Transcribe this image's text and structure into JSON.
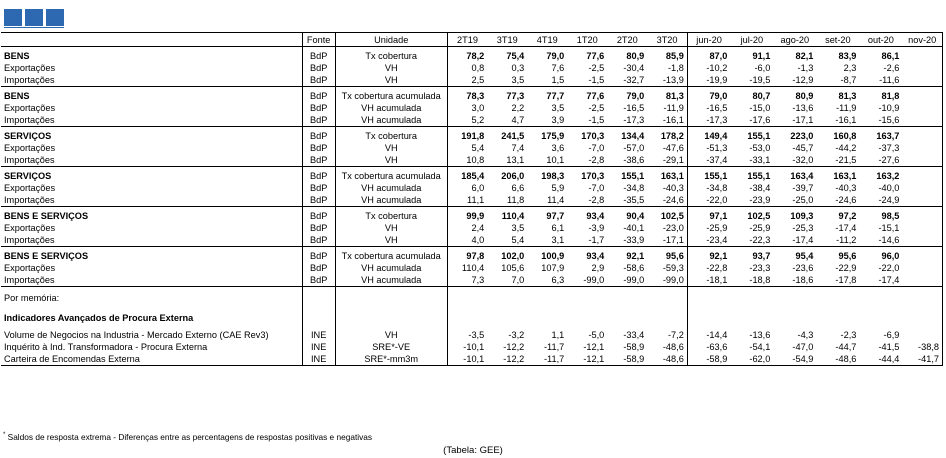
{
  "columns": {
    "fonte": "Fonte",
    "unidade": "Unidade",
    "periods": [
      "2T19",
      "3T19",
      "4T19",
      "1T20",
      "2T20",
      "3T20",
      "jun-20",
      "jul-20",
      "ago-20",
      "set-20",
      "out-20",
      "nov-20"
    ]
  },
  "blocks": [
    {
      "rows": [
        {
          "label": "BENS",
          "src": "BdP",
          "unit": "Tx cobertura",
          "values": [
            "78,2",
            "75,4",
            "79,0",
            "77,6",
            "80,9",
            "85,9",
            "87,0",
            "91,1",
            "82,1",
            "83,9",
            "86,1",
            ""
          ]
        },
        {
          "label": "Exportações",
          "src": "BdP",
          "unit": "VH",
          "values": [
            "0,8",
            "0,3",
            "7,6",
            "-2,5",
            "-30,4",
            "-1,8",
            "-10,2",
            "-6,0",
            "-1,3",
            "2,3",
            "-2,6",
            ""
          ]
        },
        {
          "label": "Importações",
          "src": "BdP",
          "unit": "VH",
          "values": [
            "2,5",
            "3,5",
            "1,5",
            "-1,5",
            "-32,7",
            "-13,9",
            "-19,9",
            "-19,5",
            "-12,9",
            "-8,7",
            "-11,6",
            ""
          ]
        }
      ]
    },
    {
      "rows": [
        {
          "label": "BENS",
          "src": "BdP",
          "unit": "Tx cobertura acumulada",
          "values": [
            "78,3",
            "77,3",
            "77,7",
            "77,6",
            "79,0",
            "81,3",
            "79,0",
            "80,7",
            "80,9",
            "81,3",
            "81,8",
            ""
          ]
        },
        {
          "label": "Exportações",
          "src": "BdP",
          "unit": "VH acumulada",
          "values": [
            "3,0",
            "2,2",
            "3,5",
            "-2,5",
            "-16,5",
            "-11,9",
            "-16,5",
            "-15,0",
            "-13,6",
            "-11,9",
            "-10,9",
            ""
          ]
        },
        {
          "label": "Importações",
          "src": "BdP",
          "unit": "VH acumulada",
          "values": [
            "5,2",
            "4,7",
            "3,9",
            "-1,5",
            "-17,3",
            "-16,1",
            "-17,3",
            "-17,6",
            "-17,1",
            "-16,1",
            "-15,6",
            ""
          ]
        }
      ]
    },
    {
      "rows": [
        {
          "label": "SERVIÇOS",
          "src": "BdP",
          "unit": "Tx cobertura",
          "values": [
            "191,8",
            "241,5",
            "175,9",
            "170,3",
            "134,4",
            "178,2",
            "149,4",
            "155,1",
            "223,0",
            "160,8",
            "163,7",
            ""
          ]
        },
        {
          "label": "Exportações",
          "src": "BdP",
          "unit": "VH",
          "values": [
            "5,4",
            "7,4",
            "3,6",
            "-7,0",
            "-57,0",
            "-47,6",
            "-51,3",
            "-53,0",
            "-45,7",
            "-44,2",
            "-37,3",
            ""
          ]
        },
        {
          "label": "Importações",
          "src": "BdP",
          "unit": "VH",
          "values": [
            "10,8",
            "13,1",
            "10,1",
            "-2,8",
            "-38,6",
            "-29,1",
            "-37,4",
            "-33,1",
            "-32,0",
            "-21,5",
            "-27,6",
            ""
          ]
        }
      ]
    },
    {
      "rows": [
        {
          "label": "SERVIÇOS",
          "src": "BdP",
          "unit": "Tx cobertura acumulada",
          "values": [
            "185,4",
            "206,0",
            "198,3",
            "170,3",
            "155,1",
            "163,1",
            "155,1",
            "155,1",
            "163,4",
            "163,1",
            "163,2",
            ""
          ]
        },
        {
          "label": "Exportações",
          "src": "BdP",
          "unit": "VH acumulada",
          "values": [
            "6,0",
            "6,6",
            "5,9",
            "-7,0",
            "-34,8",
            "-40,3",
            "-34,8",
            "-38,4",
            "-39,7",
            "-40,3",
            "-40,0",
            ""
          ]
        },
        {
          "label": "Importações",
          "src": "BdP",
          "unit": "VH acumulada",
          "values": [
            "11,1",
            "11,8",
            "11,4",
            "-2,8",
            "-35,5",
            "-24,6",
            "-22,0",
            "-23,9",
            "-25,0",
            "-24,6",
            "-24,9",
            ""
          ]
        }
      ]
    },
    {
      "rows": [
        {
          "label": "BENS E SERVIÇOS",
          "src": "BdP",
          "unit": "Tx cobertura",
          "values": [
            "99,9",
            "110,4",
            "97,7",
            "93,4",
            "90,4",
            "102,5",
            "97,1",
            "102,5",
            "109,3",
            "97,2",
            "98,5",
            ""
          ]
        },
        {
          "label": "Exportações",
          "src": "BdP",
          "unit": "VH",
          "values": [
            "2,4",
            "3,5",
            "6,1",
            "-3,9",
            "-40,1",
            "-23,0",
            "-25,9",
            "-25,9",
            "-25,3",
            "-17,4",
            "-15,1",
            ""
          ]
        },
        {
          "label": "Importações",
          "src": "BdP",
          "unit": "VH",
          "values": [
            "4,0",
            "5,4",
            "3,1",
            "-1,7",
            "-33,9",
            "-17,1",
            "-23,4",
            "-22,3",
            "-17,4",
            "-11,2",
            "-14,6",
            ""
          ]
        }
      ]
    },
    {
      "rows": [
        {
          "label": "BENS E SERVIÇOS",
          "src": "BdP",
          "unit": "Tx cobertura acumulada",
          "values": [
            "97,8",
            "102,0",
            "100,9",
            "93,4",
            "92,1",
            "95,6",
            "92,1",
            "93,7",
            "95,4",
            "95,6",
            "96,0",
            ""
          ]
        },
        {
          "label": "Exportações",
          "src": "BdP",
          "unit": "VH acumulada",
          "values": [
            "110,4",
            "105,6",
            "107,9",
            "2,9",
            "-58,6",
            "-59,3",
            "-22,8",
            "-23,3",
            "-23,6",
            "-22,9",
            "-22,0",
            ""
          ]
        },
        {
          "label": "Importações",
          "src": "BdP",
          "unit": "VH acumulada",
          "values": [
            "7,3",
            "7,0",
            "6,3",
            "-99,0",
            "-99,0",
            "-99,0",
            "-18,1",
            "-18,8",
            "-18,6",
            "-17,8",
            "-17,4",
            ""
          ]
        }
      ]
    }
  ],
  "memo": {
    "title": "Por memória:",
    "subtitle": "Indicadores Avançados de Procura Externa",
    "rows": [
      {
        "label": "Volume de Negocios na Industria - Mercado Externo (CAE Rev3)",
        "src": "INE",
        "unit": "VH",
        "values": [
          "-3,5",
          "-3,2",
          "1,1",
          "-5,0",
          "-33,4",
          "-7,2",
          "-14,4",
          "-13,6",
          "-4,3",
          "-2,3",
          "-6,9",
          ""
        ]
      },
      {
        "label": "Inquérito à Ind. Transformadora - Procura Externa",
        "src": "INE",
        "unit": "SRE*-VE",
        "values": [
          "-10,1",
          "-12,2",
          "-11,7",
          "-12,1",
          "-58,9",
          "-48,6",
          "-63,6",
          "-54,1",
          "-47,0",
          "-44,7",
          "-41,5",
          "-38,8"
        ]
      },
      {
        "label": "Carteira de Encomendas Externa",
        "src": "INE",
        "unit": "SRE*-mm3m",
        "values": [
          "-10,1",
          "-12,2",
          "-11,7",
          "-12,1",
          "-58,9",
          "-48,6",
          "-58,9",
          "-62,0",
          "-54,9",
          "-48,6",
          "-44,4",
          "-41,7"
        ]
      }
    ]
  },
  "footnote": "Saldos de resposta extrema - Diferenças entre as percentagens de respostas positivas e negativas",
  "footnote_mark": "*",
  "source": "(Tabela: GEE)",
  "colors": {
    "logo": "#2c69b1"
  }
}
